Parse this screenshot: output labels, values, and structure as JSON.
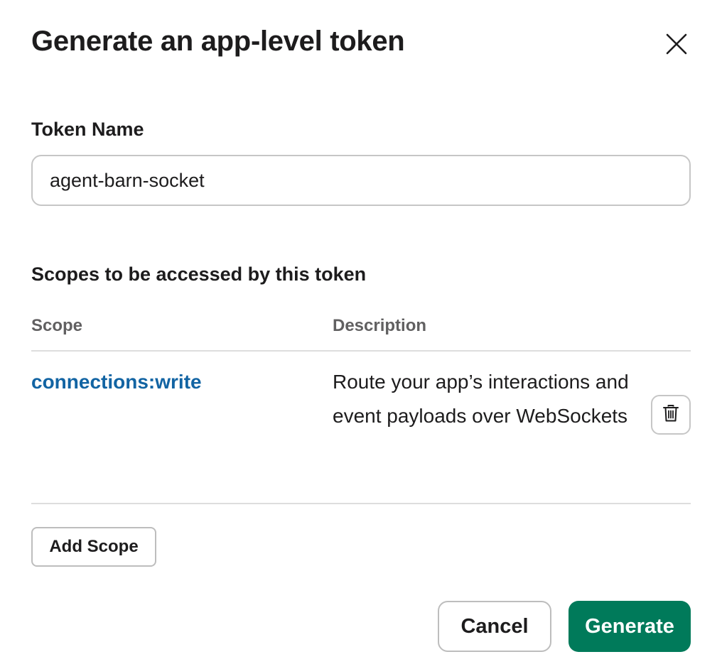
{
  "dialog": {
    "title": "Generate an app-level token",
    "close_icon": "close-icon"
  },
  "token_name": {
    "label": "Token Name",
    "value": "agent-barn-socket"
  },
  "scopes": {
    "heading": "Scopes to be accessed by this token",
    "columns": {
      "scope": "Scope",
      "description": "Description"
    },
    "rows": [
      {
        "scope": "connections:write",
        "description": "Route your app’s interactions and event payloads over WebSockets",
        "delete_icon": "trash-icon"
      }
    ],
    "add_label": "Add Scope"
  },
  "footer": {
    "cancel_label": "Cancel",
    "generate_label": "Generate"
  },
  "colors": {
    "link": "#1264a3",
    "primary": "#007a5a",
    "border": "#c6c6c6",
    "text": "#1d1c1d",
    "muted": "#616061"
  }
}
